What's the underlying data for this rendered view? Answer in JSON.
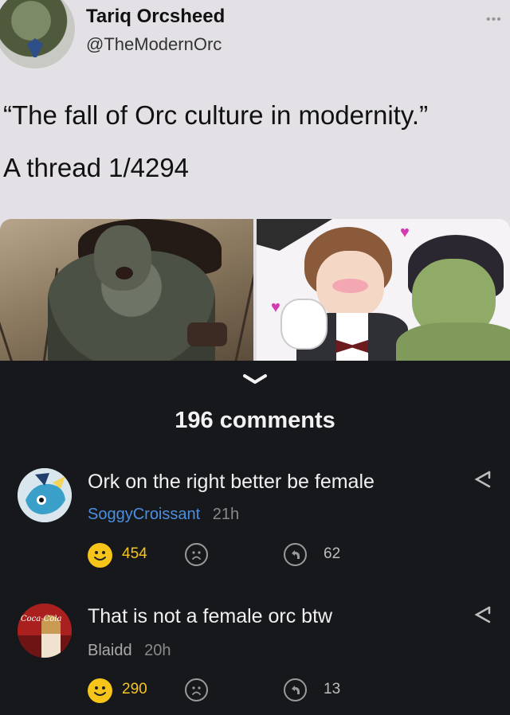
{
  "tweet": {
    "name": "Tariq Orcsheed",
    "handle": "@TheModernOrc",
    "text_line1": "“The fall of Orc culture in modernity.”",
    "text_line2": "A thread 1/4294",
    "more_icon": "ellipsis-icon"
  },
  "comments_header": {
    "count_label": "196 comments",
    "collapse_icon": "chevron-down-icon"
  },
  "comments": [
    {
      "text": "Ork on the right better be female",
      "username": "SoggyCroissant",
      "time": "21h",
      "likes": "454",
      "replies": "62",
      "username_color": "#4a8fe0"
    },
    {
      "text": "That is not a female orc btw",
      "username": "Blaidd",
      "time": "20h",
      "likes": "290",
      "replies": "13",
      "username_color": "#a9a9a9"
    }
  ],
  "colors": {
    "background": "#17181c",
    "tweet_background": "#e3e1e5",
    "like_count": "#f7c51a",
    "emoji_yellow": "#f7c51a",
    "muted": "#9a9a9a"
  }
}
